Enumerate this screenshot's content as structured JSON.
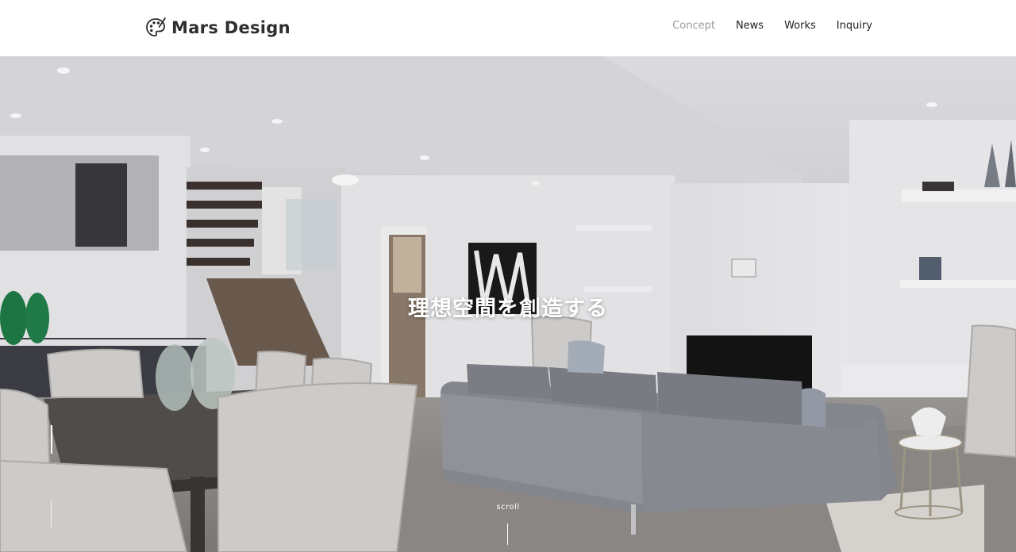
{
  "header": {
    "logo_text": "Mars Design",
    "logo_icon": "palette-icon"
  },
  "nav": {
    "items": [
      {
        "label": "Concept",
        "active": true
      },
      {
        "label": "News",
        "active": false
      },
      {
        "label": "Works",
        "active": false
      },
      {
        "label": "Inquiry",
        "active": false
      }
    ]
  },
  "hero": {
    "title": "理想空間を創造する",
    "scroll_label": "scroll",
    "image_alt": "interior-photo"
  },
  "colors": {
    "nav_active": "#9a9a9a",
    "nav_default": "#222222",
    "logo_text": "#2e2e2e",
    "hero_text": "#ffffff"
  }
}
